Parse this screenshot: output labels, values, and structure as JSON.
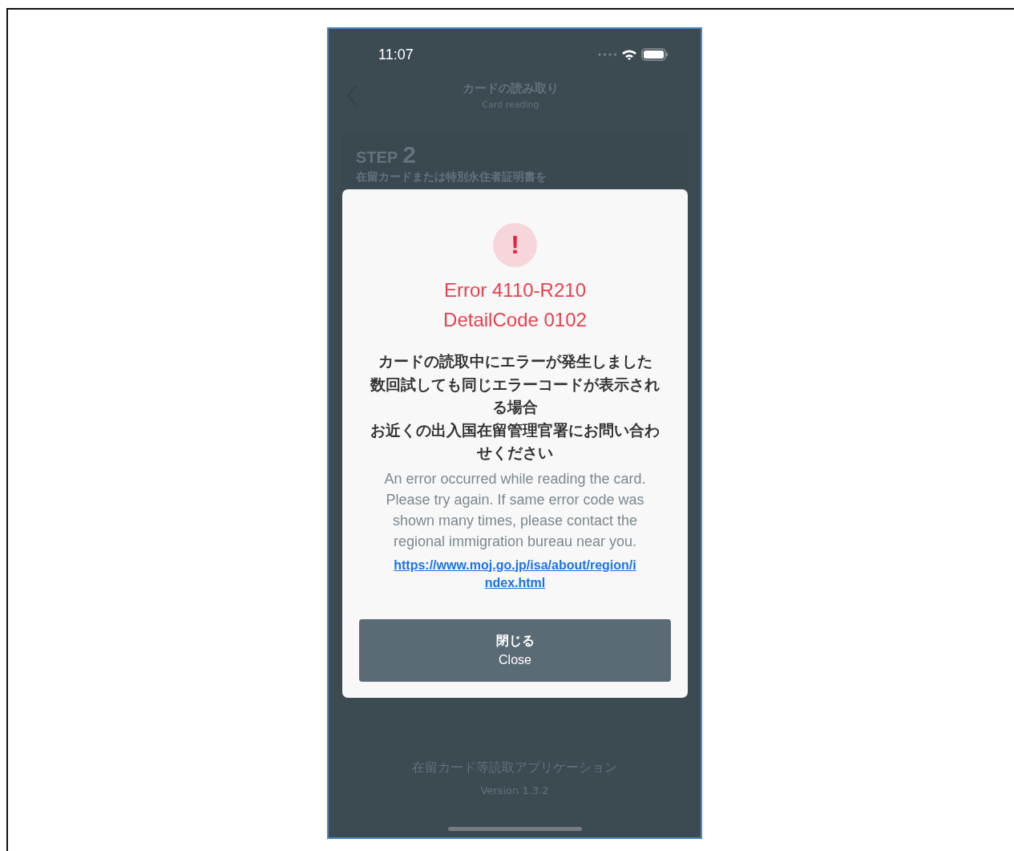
{
  "status_bar": {
    "time": "11:07"
  },
  "header": {
    "title": "カードの読み取り",
    "subtitle": "Card reading"
  },
  "step": {
    "label": "STEP",
    "number": "2",
    "text": "在留カードまたは特別永住者証明書を"
  },
  "footer": {
    "app_name": "在留カード等読取アプリケーション",
    "version": "Version 1.3.2"
  },
  "dialog": {
    "icon": "!",
    "error_lines": [
      "Error 4110-R210",
      "DetailCode 0102"
    ],
    "message_ja": [
      "カードの読取中にエラーが発生しました",
      "数回試しても同じエラーコードが表示される場合",
      "お近くの出入国在留管理官署にお問い合わせください"
    ],
    "message_en": "An error occurred while reading the card. Please try again. If same error code was shown many times, please contact the regional immigration bureau near you.",
    "link": "https://www.moj.go.jp/isa/about/region/index.html",
    "button": {
      "label_ja": "閉じる",
      "label_en": "Close"
    }
  }
}
